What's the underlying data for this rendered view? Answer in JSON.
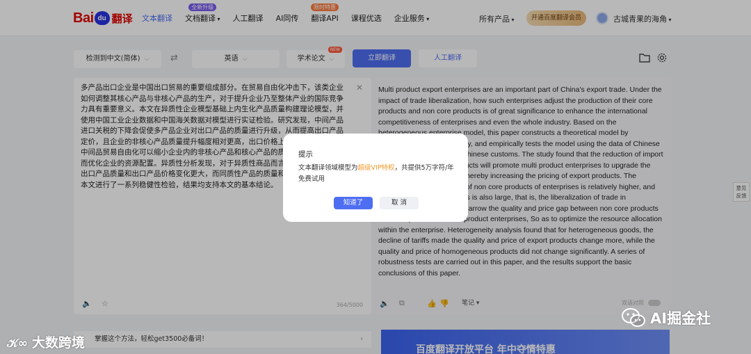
{
  "header": {
    "logo": {
      "bai": "Bai",
      "du": "du",
      "fanyi": "翻译"
    },
    "nav": [
      {
        "label": "文本翻译",
        "active": true,
        "badge": ""
      },
      {
        "label": "文档翻译",
        "active": false,
        "badge": "全新升级",
        "dropdown": true
      },
      {
        "label": "人工翻译",
        "active": false,
        "badge": ""
      },
      {
        "label": "AI同传",
        "active": false,
        "badge": ""
      },
      {
        "label": "翻译API",
        "active": false,
        "badge": "限时特惠"
      },
      {
        "label": "课程优选",
        "active": false,
        "badge": ""
      },
      {
        "label": "企业服务",
        "active": false,
        "badge": "",
        "dot": true
      }
    ],
    "all_products": "所有产品",
    "vip_button": "开通百度翻译会员",
    "username": "古城青果的海角"
  },
  "toolbar": {
    "source_lang": "检测到中文(简体)",
    "target_lang": "英语",
    "domain": "学术论文",
    "new_badge": "NEW",
    "translate_button": "立即翻译",
    "human_button": "人工翻译"
  },
  "source": {
    "text": "多产品出口企业是中国出口贸易的重要组成部分。在贸易自由化冲击下，该类企业如何调整其核心产品与非核心产品的生产，对于提升企业乃至整体产业的国际竞争力具有重要意义。本文在异质性企业模型基础上内生化产品质量构建理论模型，并使用中国工业企业数据和中国海关数据对模型进行实证检验。研究发现，中间产品进口关税的下降会促使多产品企业对出口产品的质量进行升级，从而提高出口产品定价，且企业的非核心产品质量提升幅度相对更高，出口价格上升的幅度也大，即中间品贸易自由化可以缩小企业内的非核心产品和核心产品的质量和价格差距，从而优化企业的资源配置。异质性分析发现，对于异质性商品而言，关税下降使企业出口产品质量和出口产品价格变化更大，而同质性产品的质量和价格变化不明显。本文进行了一系列稳健性检验，结果均支持本文的基本结论。",
    "counter": "364/5000"
  },
  "target": {
    "text": "Multi product export enterprises are an important part of China's export trade. Under the impact of trade liberalization, how such enterprises adjust the production of their core products and non core products is of great significance to enhance the international competitiveness of enterprises and even the whole industry. Based on the heterogeneous enterprise model, this paper constructs a theoretical model by endogenizing product quality, and empirically tests the model using the data of Chinese industrial enterprises and Chinese customs. The study found that the reduction of import tariffs on intermediate products will promote multi product enterprises to upgrade the quality of export products, thereby increasing the pricing of export products. The improvement of the quality of non core products of enterprises is relatively higher, and the increase of export prices is also large, that is, the liberalization of trade in intermediate products can narrow the quality and price gap between non core products and core products in multi product enterprises, So as to optimize the resource allocation within the enterprise. Heterogeneity analysis found that for heterogeneous goods, the decline of tariffs made the quality and price of export products change more, while the quality and price of homogeneous products did not change significantly. A series of robustness tests are carried out in this paper, and the results support the basic conclusions of this paper.",
    "note_label": "笔记",
    "dual_label": "双语对照"
  },
  "dialog": {
    "title": "提示",
    "body_prefix": "文本翻译领域模型为",
    "body_highlight": "超级VIP特权",
    "body_suffix": "，共提供5万字符/年免费试用",
    "ok": "知道了",
    "cancel": "取 消"
  },
  "bottom": {
    "tip": "掌握这个方法，轻松get3500必备词！",
    "banner": "百度翻译开放平台 年中夺情特惠"
  },
  "side_feedback": "意见反馈",
  "watermarks": {
    "right": "AI掘金社",
    "left": "大数跨境"
  },
  "colors": {
    "accent": "#4e6ef2",
    "brand_red": "#e10602",
    "highlight": "#f09a2a"
  }
}
